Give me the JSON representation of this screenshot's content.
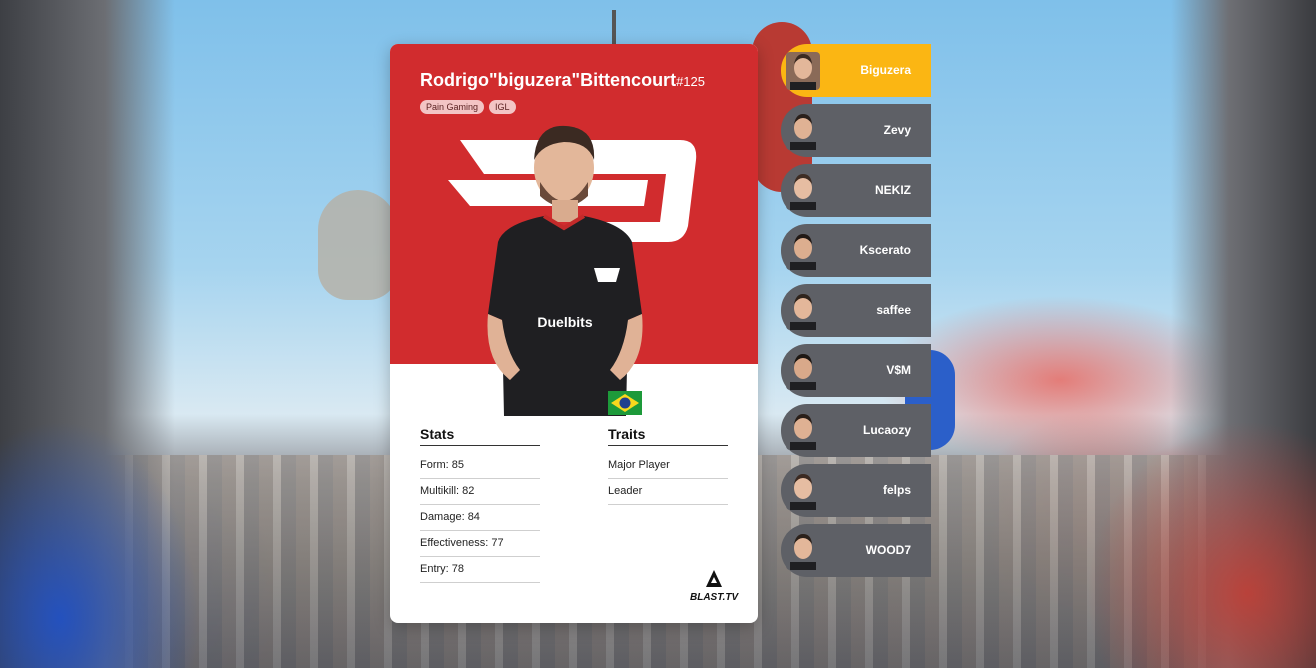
{
  "card": {
    "player_name": "Rodrigo\"biguzera\"Bittencourt",
    "player_number": "#125",
    "tags": [
      "Pain Gaming",
      "IGL"
    ],
    "accent_color": "#d12c2e",
    "jersey_sponsor": "Duelbits",
    "stats_title": "Stats",
    "stats": [
      "Form: 85",
      "Multikill: 82",
      "Damage: 84",
      "Effectiveness: 77",
      "Entry: 78"
    ],
    "traits_title": "Traits",
    "traits": [
      "Major Player",
      "Leader"
    ],
    "brand": "BLAST.TV",
    "flag": "brazil-flag-icon"
  },
  "roster": {
    "active_color": "#fbb613",
    "inactive_color": "#5e6066",
    "players": [
      "Biguzera",
      "Zevy",
      "NEKIZ",
      "Kscerato",
      "saffee",
      "V$M",
      "Lucaozy",
      "felps",
      "WOOD7"
    ],
    "active_index": 0
  }
}
